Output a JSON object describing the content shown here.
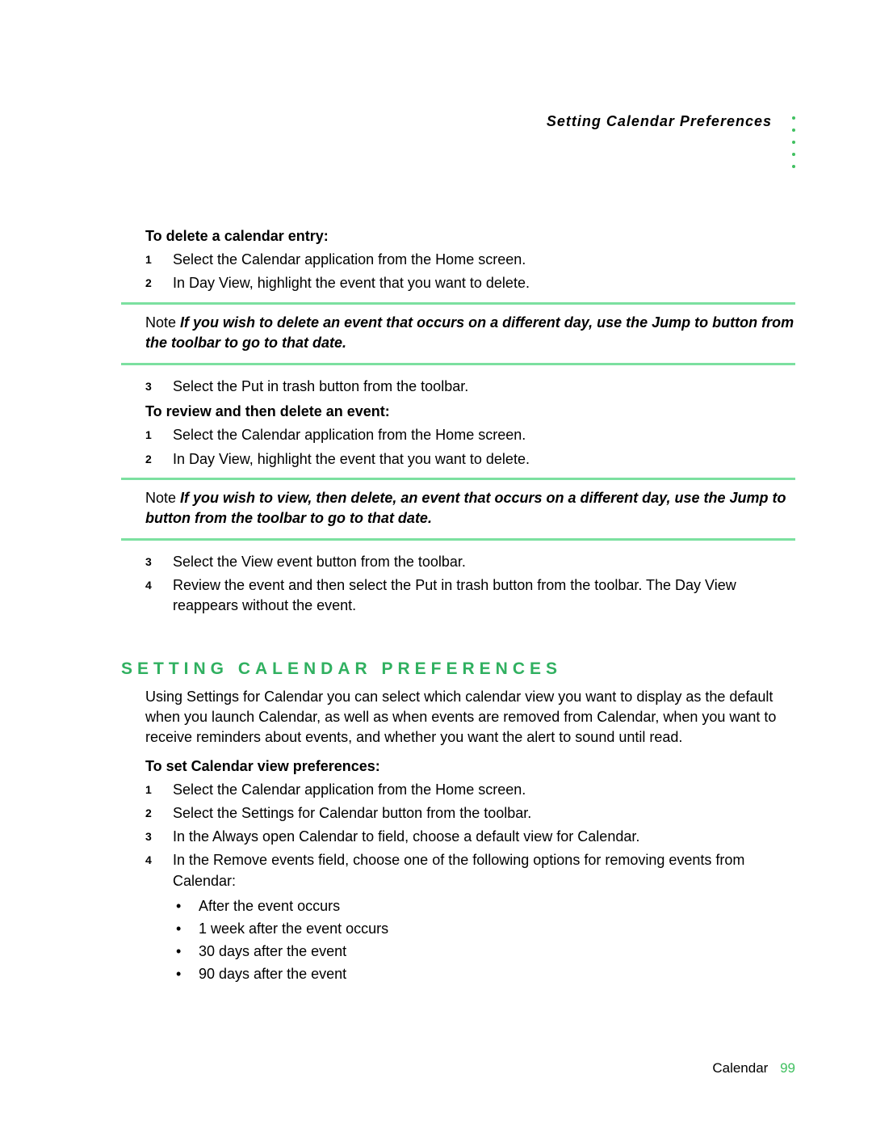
{
  "header": {
    "title": "Setting Calendar Preferences"
  },
  "section1": {
    "heading": "To delete a calendar entry:",
    "steps_a": [
      "Select the Calendar application from the Home screen.",
      "In Day View, highlight the event that you want to delete."
    ],
    "note_label": "Note",
    "note_text": "If you wish to delete an event that occurs on a different day, use the Jump to button from the toolbar to go to that date.",
    "steps_b": [
      "Select the Put in trash button from the toolbar."
    ]
  },
  "section2": {
    "heading": "To review and then delete an event:",
    "steps_a": [
      "Select the Calendar application from the Home screen.",
      "In Day View, highlight the event that you want to delete."
    ],
    "note_label": "Note",
    "note_text": "If you wish to view, then delete, an event that occurs on a different day, use the Jump to button from the toolbar to go to that date.",
    "steps_b": [
      "Select the View event button from the toolbar.",
      "Review the event and then select the Put in trash button from the toolbar. The Day View reappears without the event."
    ]
  },
  "section3": {
    "title": "SETTING CALENDAR PREFERENCES",
    "intro": "Using Settings for Calendar you can select which calendar view you want to display as the default when you launch Calendar, as well as when events are removed from Calendar, when you want to receive reminders about events, and whether you want the alert to sound until read.",
    "heading": "To set Calendar view preferences:",
    "steps": [
      "Select the Calendar application from the Home screen.",
      "Select the Settings for Calendar button from the toolbar.",
      "In the Always open Calendar to field, choose a default view for Calendar.",
      "In the Remove events field, choose one of the following options for removing events from Calendar:"
    ],
    "bullets": [
      "After the event occurs",
      "1 week after the event occurs",
      "30 days after the event",
      "90 days after the event"
    ]
  },
  "nums": {
    "n1": "1",
    "n2": "2",
    "n3": "3",
    "n4": "4"
  },
  "footer": {
    "section": "Calendar",
    "page": "99"
  }
}
